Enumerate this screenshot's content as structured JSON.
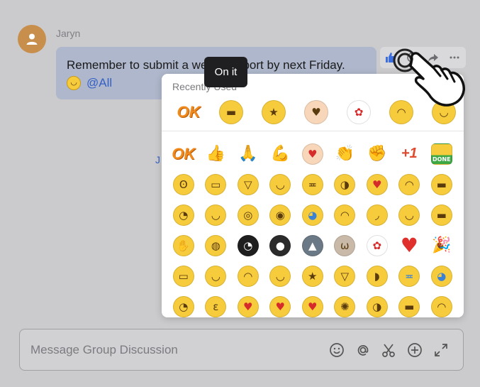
{
  "message": {
    "sender": "Jaryn",
    "text_line1": "Remember to submit a weekly report by next Friday.",
    "mention": "@All",
    "stray_text": "J"
  },
  "reaction_picker": {
    "tooltip": "On it",
    "recent_title": "Recently Used",
    "recent": [
      {
        "name": "ok-sticker",
        "type": "ok",
        "label": "OK"
      },
      {
        "name": "loading-face",
        "glyph": "▬",
        "bg": "#f6cb3c"
      },
      {
        "name": "star-eyes-face",
        "glyph": "★",
        "bg": "#f6cb3c"
      },
      {
        "name": "finger-heart",
        "glyph": "♥",
        "bg": "#f7d6b9"
      },
      {
        "name": "rose",
        "glyph": "✿",
        "bg": "#ffffff",
        "color": "#d62b2b"
      },
      {
        "name": "salute-face",
        "glyph": "◠",
        "bg": "#f6cb3c"
      },
      {
        "name": "smirk-face",
        "glyph": "◡",
        "bg": "#f6cb3c"
      }
    ],
    "grid": [
      {
        "name": "ok-sticker",
        "type": "ok",
        "label": "OK"
      },
      {
        "name": "thumbs-up",
        "glyph": "👍",
        "type": "plain"
      },
      {
        "name": "pray-hands",
        "glyph": "🙏",
        "type": "plain"
      },
      {
        "name": "flexed-arm",
        "glyph": "💪",
        "type": "plain"
      },
      {
        "name": "finger-heart",
        "glyph": "♥",
        "bg": "#f7d6b9",
        "color": "#d62b2b"
      },
      {
        "name": "clap",
        "glyph": "👏",
        "type": "plain"
      },
      {
        "name": "fist-bump",
        "glyph": "✊",
        "type": "plain"
      },
      {
        "name": "plus-one",
        "type": "plusone",
        "label": "+1"
      },
      {
        "name": "done-sticker",
        "type": "done",
        "label": "DONE"
      },
      {
        "name": "wow-face",
        "glyph": "ʘ",
        "bg": "#f6cb3c"
      },
      {
        "name": "grin-face",
        "glyph": "▭",
        "bg": "#f6cb3c"
      },
      {
        "name": "laugh-face",
        "glyph": "▽",
        "bg": "#f6cb3c"
      },
      {
        "name": "smile-eyes-face",
        "glyph": "◡",
        "bg": "#f6cb3c"
      },
      {
        "name": "joy-face",
        "glyph": "≖",
        "bg": "#f6cb3c"
      },
      {
        "name": "rofl-face",
        "glyph": "◑",
        "bg": "#f6cb3c"
      },
      {
        "name": "heart-kiss-face",
        "glyph": "♥",
        "bg": "#f6cb3c",
        "color": "#d62b2b"
      },
      {
        "name": "wink-face",
        "glyph": "◠",
        "bg": "#f6cb3c"
      },
      {
        "name": "cool-face",
        "glyph": "▬",
        "bg": "#f6cb3c"
      },
      {
        "name": "thinking-face",
        "glyph": "◔",
        "bg": "#f6cb3c"
      },
      {
        "name": "smug-face",
        "glyph": "◡",
        "bg": "#f6cb3c"
      },
      {
        "name": "dizzy-face",
        "glyph": "◎",
        "bg": "#f6cb3c"
      },
      {
        "name": "eye-roll-face",
        "glyph": "◉",
        "bg": "#f6cb3c"
      },
      {
        "name": "crying-face",
        "glyph": "◕",
        "bg": "#f6cb3c",
        "color": "#3b82d6"
      },
      {
        "name": "shy-face",
        "glyph": "◠",
        "bg": "#f6cb3c"
      },
      {
        "name": "smirk-face",
        "glyph": "◞",
        "bg": "#f6cb3c"
      },
      {
        "name": "blush-face",
        "glyph": "◡",
        "bg": "#f6cb3c"
      },
      {
        "name": "unamused-face",
        "glyph": "▬",
        "bg": "#f6cb3c"
      },
      {
        "name": "facepalm-face",
        "glyph": "✋",
        "bg": "#f6cb3c"
      },
      {
        "name": "puke-face",
        "glyph": "◍",
        "bg": "#f6cb3c"
      },
      {
        "name": "sweat-black-face",
        "glyph": "◔",
        "bg": "#1e1e1e",
        "color": "#ffffff"
      },
      {
        "name": "black-face",
        "glyph": "●",
        "bg": "#2b2b2b",
        "color": "#ffffff"
      },
      {
        "name": "husky-face",
        "glyph": "▲",
        "bg": "#6b7885",
        "color": "#ffffff"
      },
      {
        "name": "cat-face",
        "glyph": "ω",
        "bg": "#c9b9a8"
      },
      {
        "name": "rose",
        "glyph": "✿",
        "bg": "#ffffff",
        "color": "#d62b2b"
      },
      {
        "name": "red-heart",
        "glyph": "♥",
        "type": "heart"
      },
      {
        "name": "party-popper",
        "glyph": "🎉",
        "type": "plain"
      },
      {
        "name": "grimace-face",
        "glyph": "▭",
        "bg": "#f6cb3c"
      },
      {
        "name": "relieved-face",
        "glyph": "◡",
        "bg": "#f6cb3c"
      },
      {
        "name": "giggle-face",
        "glyph": "◠",
        "bg": "#f6cb3c"
      },
      {
        "name": "smile-face",
        "glyph": "◡",
        "bg": "#f6cb3c"
      },
      {
        "name": "starstruck-face",
        "glyph": "★",
        "bg": "#f6cb3c"
      },
      {
        "name": "big-grin-face",
        "glyph": "▽",
        "bg": "#f6cb3c"
      },
      {
        "name": "tongue-face",
        "glyph": "◗",
        "bg": "#f6cb3c"
      },
      {
        "name": "tears-joy-face",
        "glyph": "≖",
        "bg": "#f6cb3c",
        "color": "#3b82d6"
      },
      {
        "name": "sob-face",
        "glyph": "◕",
        "bg": "#f6cb3c",
        "color": "#3b82d6"
      },
      {
        "name": "nervous-face",
        "glyph": "◔",
        "bg": "#f6cb3c"
      },
      {
        "name": "kissy-face",
        "glyph": "ε",
        "bg": "#f6cb3c"
      },
      {
        "name": "blow-kiss-face",
        "glyph": "♥",
        "bg": "#f6cb3c",
        "color": "#d62b2b"
      },
      {
        "name": "heart-eyes-face",
        "glyph": "♥",
        "bg": "#f6cb3c",
        "color": "#d62b2b"
      },
      {
        "name": "heart-eyes-grin-face",
        "glyph": "♥",
        "bg": "#f6cb3c",
        "color": "#d62b2b"
      },
      {
        "name": "dizzy-eyes-face",
        "glyph": "✺",
        "bg": "#f6cb3c"
      },
      {
        "name": "crazy-face",
        "glyph": "◑",
        "bg": "#f6cb3c"
      },
      {
        "name": "shades-face",
        "glyph": "▬",
        "bg": "#f6cb3c"
      },
      {
        "name": "peek-face",
        "glyph": "◠",
        "bg": "#f6cb3c"
      }
    ]
  },
  "composer": {
    "placeholder": "Message Group Discussion",
    "icons": [
      "emoji-icon",
      "mention-icon",
      "scissors-icon",
      "add-icon",
      "expand-icon"
    ]
  },
  "colors": {
    "background": "#cbcbcd",
    "bubble": "#aeb7cb",
    "accent": "#3460c6",
    "avatar": "#c88e4c"
  }
}
